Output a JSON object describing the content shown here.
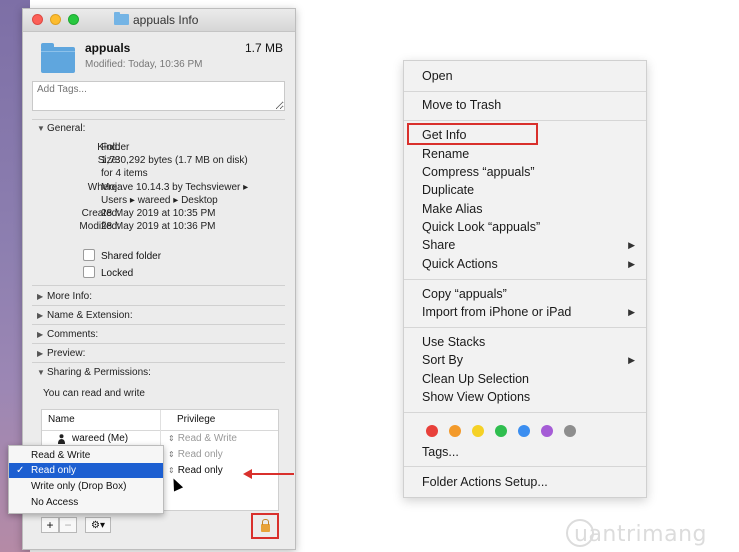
{
  "info_window": {
    "title": "appuals Info",
    "name": "appuals",
    "size": "1.7 MB",
    "modified_line": "Modified: Today, 10:36 PM",
    "tags_placeholder": "Add Tags...",
    "general_label": "General:",
    "general": {
      "kind_k": "Kind:",
      "kind_v": "Folder",
      "size_k": "Size:",
      "size_v1": "1,730,292 bytes (1.7 MB on disk)",
      "size_v2": "for 4 items",
      "where_k": "Where:",
      "where_v1": "Mojave 10.14.3 by Techsviewer ▸",
      "where_v2": "Users ▸ wareed ▸ Desktop",
      "created_k": "Created:",
      "created_v": "28 May 2019 at 10:35 PM",
      "modified_k": "Modified:",
      "modified_v": "28 May 2019 at 10:36 PM"
    },
    "shared_folder": "Shared folder",
    "locked": "Locked",
    "sections": {
      "more_info": "More Info:",
      "name_ext": "Name & Extension:",
      "comments": "Comments:",
      "preview": "Preview:",
      "sharing": "Sharing & Permissions:"
    },
    "sharing_status": "You can read and write",
    "table": {
      "col_name": "Name",
      "col_privilege": "Privilege",
      "rows": [
        {
          "name": "wareed (Me)",
          "privilege": "Read & Write"
        },
        {
          "name": "",
          "privilege": "Read only"
        },
        {
          "name": "",
          "privilege": "Read only"
        }
      ]
    },
    "popup_options": [
      "Read & Write",
      "Read only",
      "Write only (Drop Box)",
      "No Access"
    ],
    "popup_selected": "Read only",
    "btn_add": "+",
    "btn_remove": "−",
    "btn_action": "⚙▾"
  },
  "context_menu": {
    "open": "Open",
    "move_to_trash": "Move to Trash",
    "get_info": "Get Info",
    "rename": "Rename",
    "compress": "Compress “appuals”",
    "duplicate": "Duplicate",
    "make_alias": "Make Alias",
    "quick_look": "Quick Look “appuals”",
    "share": "Share",
    "quick_actions": "Quick Actions",
    "copy": "Copy “appuals”",
    "import_iphone": "Import from iPhone or iPad",
    "use_stacks": "Use Stacks",
    "sort_by": "Sort By",
    "clean_up": "Clean Up Selection",
    "show_view_options": "Show View Options",
    "tag_colors": [
      "#e8403a",
      "#f39a2b",
      "#f5d126",
      "#2fbe4f",
      "#3b8ef0",
      "#a55cd6",
      "#8e8e8e"
    ],
    "tags": "Tags...",
    "folder_actions": "Folder Actions Setup..."
  },
  "watermark": "uantrimang",
  "accent_red": "#d9302c"
}
